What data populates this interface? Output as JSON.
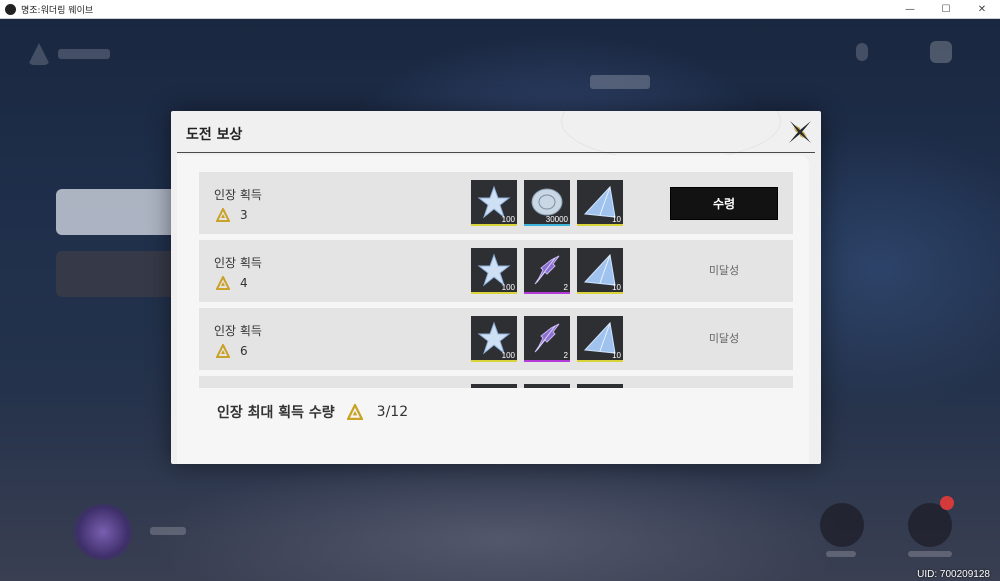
{
  "window": {
    "title": "명조:워더링 웨이브",
    "minimize": "—",
    "maximize": "☐",
    "close": "✕"
  },
  "dialog": {
    "title": "도전 보상",
    "rows": [
      {
        "label": "인장 획득",
        "count": "3",
        "items": [
          {
            "icon": "star-crystal-icon",
            "qty": "100",
            "rarity_color": "#d9d43a"
          },
          {
            "icon": "shell-coin-icon",
            "qty": "30000",
            "rarity_color": "#3ab4d9"
          },
          {
            "icon": "crystal-shard-icon",
            "qty": "10",
            "rarity_color": "#d9d43a"
          }
        ],
        "action": "수령",
        "claimable": true
      },
      {
        "label": "인장 획득",
        "count": "4",
        "items": [
          {
            "icon": "star-crystal-icon",
            "qty": "100",
            "rarity_color": "#d9d43a"
          },
          {
            "icon": "purple-feather-icon",
            "qty": "2",
            "rarity_color": "#b43ad9"
          },
          {
            "icon": "crystal-shard-icon",
            "qty": "10",
            "rarity_color": "#d9d43a"
          }
        ],
        "action": "미달성",
        "claimable": false
      },
      {
        "label": "인장 획득",
        "count": "6",
        "items": [
          {
            "icon": "star-crystal-icon",
            "qty": "100",
            "rarity_color": "#d9d43a"
          },
          {
            "icon": "purple-feather-icon",
            "qty": "2",
            "rarity_color": "#b43ad9"
          },
          {
            "icon": "crystal-shard-icon",
            "qty": "10",
            "rarity_color": "#d9d43a"
          }
        ],
        "action": "미달성",
        "claimable": false
      }
    ],
    "footer": {
      "label": "인장 최대 획득 수량",
      "value": "3/12"
    }
  },
  "uid": "UID: 700209128",
  "colors": {
    "accent_gold": "#c9a227",
    "claim_button": "#121212"
  }
}
